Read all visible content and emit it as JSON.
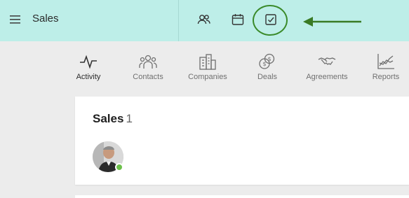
{
  "header": {
    "app_title": "Sales",
    "icons": [
      "people-icon",
      "calendar-icon",
      "task-check-icon"
    ]
  },
  "nav": {
    "items": [
      {
        "label": "Activity",
        "icon": "activity-icon",
        "active": true
      },
      {
        "label": "Contacts",
        "icon": "contacts-icon",
        "active": false
      },
      {
        "label": "Companies",
        "icon": "companies-icon",
        "active": false
      },
      {
        "label": "Deals",
        "icon": "deals-icon",
        "active": false
      },
      {
        "label": "Agreements",
        "icon": "agreements-icon",
        "active": false
      },
      {
        "label": "Reports",
        "icon": "reports-icon",
        "active": false
      }
    ]
  },
  "card": {
    "title": "Sales",
    "count": "1",
    "member_status": "online"
  },
  "colors": {
    "topbar_bg": "#bdeee8",
    "highlight": "#3a8a2a",
    "status_online": "#6cc04a"
  }
}
